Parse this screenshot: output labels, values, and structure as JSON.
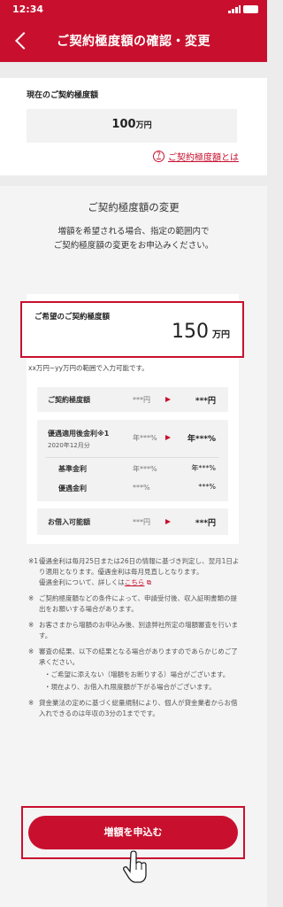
{
  "status": {
    "time": "12:34"
  },
  "nav": {
    "title": "ご契約極度額の確認・変更"
  },
  "current": {
    "label": "現在のご契約極度額",
    "value": "100",
    "unit": "万円",
    "help_link": "ご契約極度額とは"
  },
  "change": {
    "heading": "ご契約極度額の変更",
    "desc_line1": "増額を希望される場合、指定の範囲内で",
    "desc_line2": "ご契約極度額の変更をお申込みください。",
    "desired_label": "ご希望のご契約極度額",
    "desired_value": "150",
    "desired_unit": "万円",
    "range_note": "xx万円~yy万円の範囲で入力可能です。"
  },
  "rows": {
    "limit": {
      "label": "ご契約極度額",
      "current": "***円",
      "new": "***円"
    },
    "rate": {
      "label": "優遇適用後金利※1",
      "sub": "2020年12月分",
      "current": "年***%",
      "new": "年***%",
      "base_label": "基準金利",
      "base_current": "年***%",
      "base_new": "年***%",
      "pref_label": "優遇金利",
      "pref_current": "***%",
      "pref_new": "***%"
    },
    "borrow": {
      "label": "お借入可能額",
      "current": "***円",
      "new": "***円"
    }
  },
  "notes": {
    "n1_mark": "※1",
    "n1_text": "優遇金利は毎月25日または26日の情報に基づき判定し、翌月1日より適用となります。優遇金利は毎月見直しとなります。",
    "n1_more": "優遇金利について、詳しくは",
    "n1_link": "こちら",
    "n2_mark": "※",
    "n2_text": "ご契約極度額などの条件によって、申請受付後、収入証明書類の提出をお願いする場合があります。",
    "n3_mark": "※",
    "n3_text": "お客さまから増額のお申込み後、別途弊社所定の増額審査を行います。",
    "n4_mark": "※",
    "n4_text": "審査の結果、以下の結果となる場合がありますのであらかじめご了承ください。",
    "n4_b1": "・ご希望に添えない（増額をお断りする）場合がございます。",
    "n4_b2": "・現在より、お借入れ限度額が下がる場合がございます。",
    "n5_mark": "※",
    "n5_text": "貸金業法の定めに基づく総量規制により、個人が貸金業者からお借入れできるのは年収の3分の1までです。"
  },
  "cta": {
    "label": "増額を申込む"
  },
  "colors": {
    "brand": "#c8102e"
  }
}
